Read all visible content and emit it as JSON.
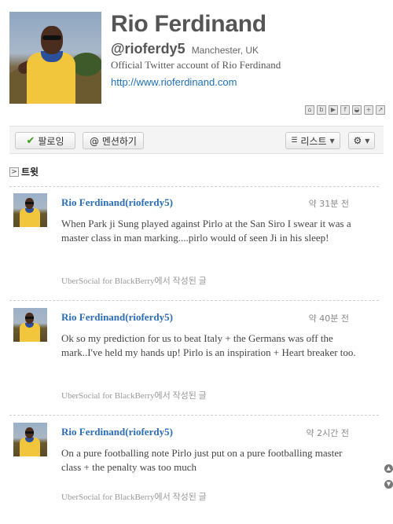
{
  "profile": {
    "name": "Rio Ferdinand",
    "handle": "@rioferdy5",
    "location": "Manchester, UK",
    "bio": "Official Twitter account of Rio Ferdinand",
    "url": "http://www.rioferdinand.com"
  },
  "share_icons": [
    "home-icon",
    "blog-icon",
    "youtube-icon",
    "facebook-icon",
    "chat-icon",
    "add-icon",
    "external-link-icon"
  ],
  "actions": {
    "follow_label": "팔로잉",
    "mention_label": "@ 멘션하기",
    "list_label": "리스트",
    "settings_icon": "gear-icon"
  },
  "tweets_section": {
    "title": "트윗"
  },
  "tweets": [
    {
      "author": "Rio Ferdinand(rioferdy5)",
      "time": "약 31분 전",
      "text": "When Park ji Sung played against Pirlo at the San Siro I swear it was a master class in man marking....pirlo would of seen Ji in his sleep!",
      "source": "UberSocial for BlackBerry에서 작성된 글"
    },
    {
      "author": "Rio Ferdinand(rioferdy5)",
      "time": "약 40분 전",
      "text": "Ok so my prediction for us to beat Italy + the Germans was off the mark..I've held my hands up! Pirlo is an inspiration + Heart breaker too.",
      "source": "UberSocial for BlackBerry에서 작성된 글"
    },
    {
      "author": "Rio Ferdinand(rioferdy5)",
      "time": "약 2시간 전",
      "text": "On a pure footballing note Pirlo just put on a pure footballing master class + the penalty was too much",
      "source": "UberSocial for BlackBerry에서 작성된 글"
    }
  ]
}
